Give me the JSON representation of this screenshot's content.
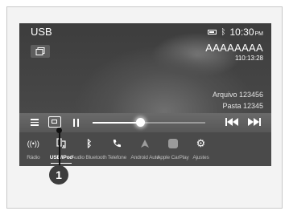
{
  "header": {
    "source_title": "USB",
    "time": "10:30",
    "ampm": "PM"
  },
  "now_playing": {
    "track_name": "AAAAAAAA",
    "track_time": "110:13:28",
    "file": "Arquivo 123456",
    "folder": "Pasta 12345",
    "progress": 0.42
  },
  "dock": {
    "items": [
      {
        "label": "Rádio"
      },
      {
        "label": "USB/iPod"
      },
      {
        "label": "Audio Bluetooth"
      },
      {
        "label": "Telefone"
      },
      {
        "label": "Android Auto"
      },
      {
        "label": "Apple CarPlay"
      },
      {
        "label": "Ajustes"
      }
    ]
  },
  "callout": {
    "number": "1"
  }
}
